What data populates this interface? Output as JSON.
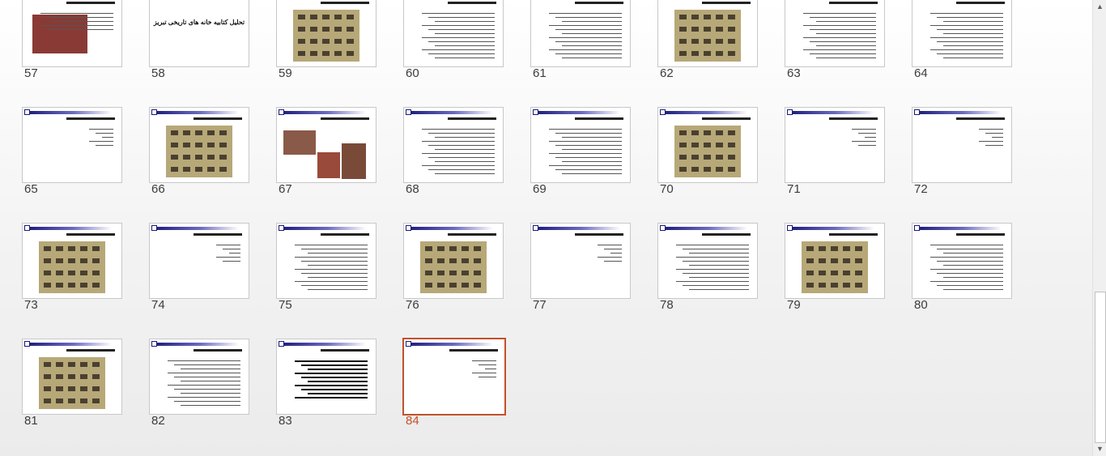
{
  "slides": [
    {
      "number": "57",
      "kind": "photo-text",
      "title": "تحلیل کتابیه خانه های تاریخی تبریز"
    },
    {
      "number": "58",
      "kind": "title",
      "title": "تحلیل کتابیه خانه های تاریخی تبریز"
    },
    {
      "number": "59",
      "kind": "photo-grid"
    },
    {
      "number": "60",
      "kind": "text"
    },
    {
      "number": "61",
      "kind": "text"
    },
    {
      "number": "62",
      "kind": "photo-grid"
    },
    {
      "number": "63",
      "kind": "text"
    },
    {
      "number": "64",
      "kind": "text"
    },
    {
      "number": "65",
      "kind": "text-short"
    },
    {
      "number": "66",
      "kind": "photo-grid"
    },
    {
      "number": "67",
      "kind": "photos"
    },
    {
      "number": "68",
      "kind": "text"
    },
    {
      "number": "69",
      "kind": "text"
    },
    {
      "number": "70",
      "kind": "photo-grid"
    },
    {
      "number": "71",
      "kind": "text-short"
    },
    {
      "number": "72",
      "kind": "text-short"
    },
    {
      "number": "73",
      "kind": "photo-grid"
    },
    {
      "number": "74",
      "kind": "text-short"
    },
    {
      "number": "75",
      "kind": "text"
    },
    {
      "number": "76",
      "kind": "photo-grid"
    },
    {
      "number": "77",
      "kind": "text-short"
    },
    {
      "number": "78",
      "kind": "text"
    },
    {
      "number": "79",
      "kind": "photo-grid"
    },
    {
      "number": "80",
      "kind": "text"
    },
    {
      "number": "81",
      "kind": "photo-grid"
    },
    {
      "number": "82",
      "kind": "text"
    },
    {
      "number": "83",
      "kind": "text-bold"
    },
    {
      "number": "84",
      "kind": "text-short",
      "selected": true
    }
  ],
  "scrollbar": {
    "up_icon": "▲",
    "down_icon": "▼"
  },
  "colors": {
    "selection": "#c4502a",
    "band": "#1a1a7a"
  }
}
